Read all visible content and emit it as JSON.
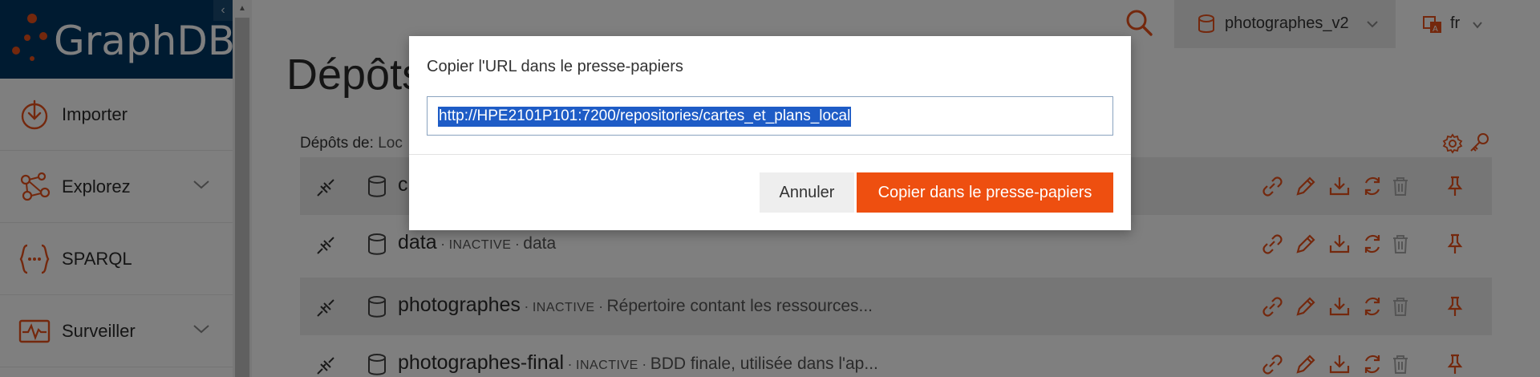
{
  "app": {
    "logo_text": "GraphDB",
    "collapse_glyph": "‹"
  },
  "sidebar": {
    "items": [
      {
        "label": "Importer",
        "icon": "import-icon",
        "has_submenu": false
      },
      {
        "label": "Explorez",
        "icon": "explore-icon",
        "has_submenu": true
      },
      {
        "label": "SPARQL",
        "icon": "sparql-icon",
        "has_submenu": false
      },
      {
        "label": "Surveiller",
        "icon": "monitor-icon",
        "has_submenu": true
      }
    ]
  },
  "header": {
    "repository": "photographes_v2",
    "language": "fr"
  },
  "main": {
    "title": "Dépôts",
    "repos_prefix": "Dépôts de:",
    "repos_location": "Loc",
    "repos": [
      {
        "name": "c",
        "status": "",
        "description": ""
      },
      {
        "name": "data",
        "status": "INACTIVE",
        "description": "data"
      },
      {
        "name": "photographes",
        "status": "INACTIVE",
        "description": "Répertoire contant les ressources..."
      },
      {
        "name": "photographes-final",
        "status": "INACTIVE",
        "description": "BDD finale, utilisée dans l'ap..."
      }
    ],
    "separator": "·"
  },
  "modal": {
    "title": "Copier l'URL dans le presse-papiers",
    "url": "http://HPE2101P101:7200/repositories/cartes_et_plans_local",
    "cancel_label": "Annuler",
    "copy_label": "Copier dans le presse-papiers"
  },
  "colors": {
    "brand_navy": "#003663",
    "accent_orange": "#ee4f10",
    "selection_blue": "#1e5cc6"
  }
}
